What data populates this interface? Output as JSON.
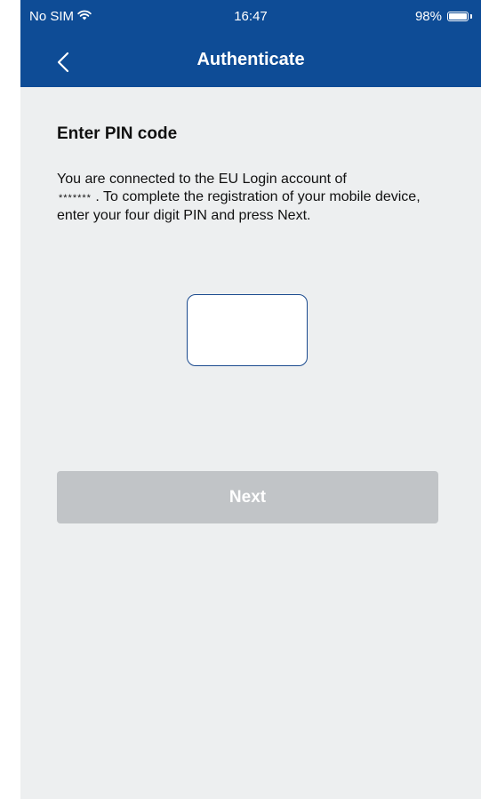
{
  "status_bar": {
    "carrier": "No SIM",
    "wifi_icon": "wifi-icon",
    "time": "16:47",
    "battery_text": "98%",
    "battery_level": 0.98,
    "battery_icon": "battery-icon"
  },
  "nav": {
    "back_icon": "chevron-left-icon",
    "title": "Authenticate"
  },
  "main": {
    "heading": "Enter PIN code",
    "desc_part1": "You are connected to the EU Login account of",
    "masked_account": "*******",
    "desc_part2": ". To complete the registration of your mobile device, enter your four digit PIN and press Next.",
    "pin_value": "",
    "next_label": "Next"
  },
  "colors": {
    "header_bg": "#0e4c96",
    "screen_bg": "#edeff0",
    "button_disabled_bg": "#c1c4c7",
    "input_border": "#1a4a8e"
  }
}
